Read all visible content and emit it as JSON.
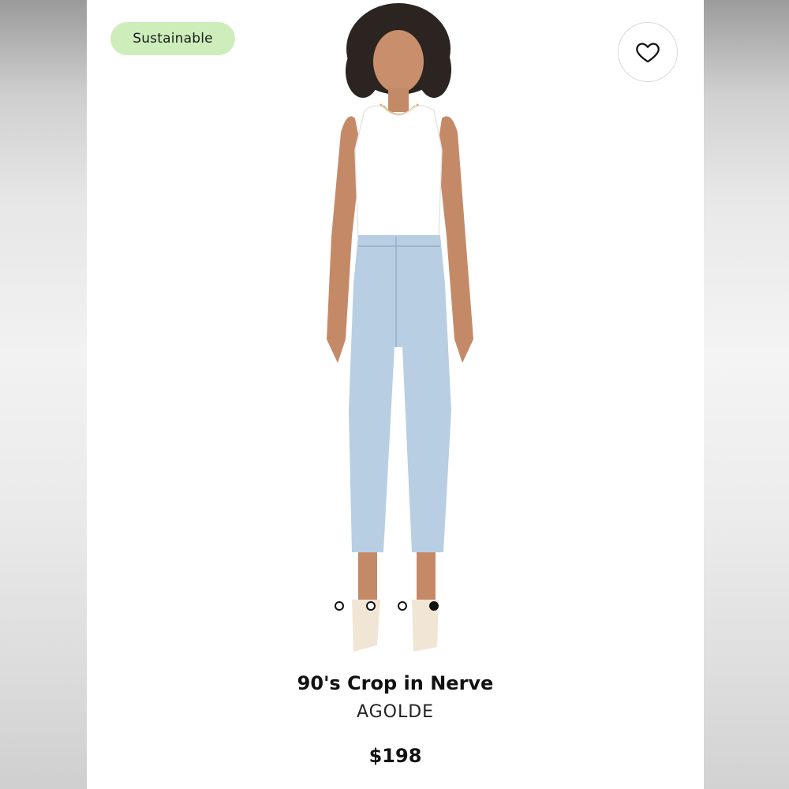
{
  "badge": {
    "label": "Sustainable",
    "color": "#cdeebb"
  },
  "favorite": {
    "icon": "heart-outline-icon"
  },
  "gallery": {
    "image": "model-wearing-light-wash-cropped-jeans",
    "dots": [
      {
        "active": false
      },
      {
        "active": false
      },
      {
        "active": false
      },
      {
        "active": true
      }
    ]
  },
  "product": {
    "title": "90's Crop in Nerve",
    "brand": "AGOLDE",
    "price": "$198"
  }
}
